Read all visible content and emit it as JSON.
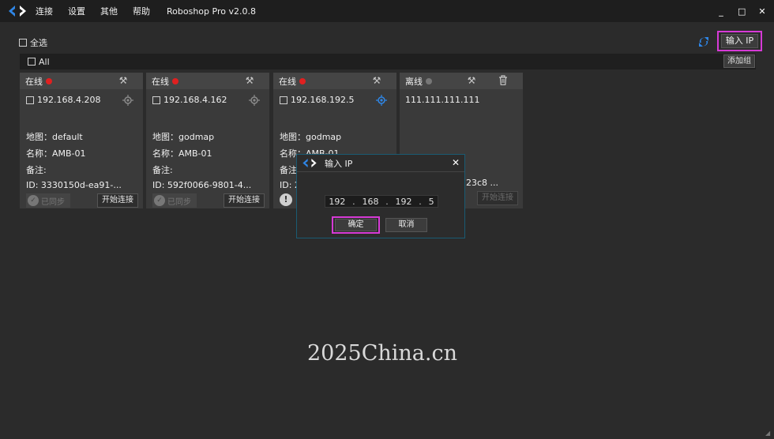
{
  "titlebar": {
    "menu": [
      "连接",
      "设置",
      "其他",
      "帮助"
    ],
    "app_title": "Roboshop Pro v2.0.8",
    "minimize": "_",
    "maximize": "□",
    "close": "✕"
  },
  "toolbar": {
    "select_all_label": "全选",
    "input_ip_label": "输入 IP",
    "add_group_label": "添加组"
  },
  "group": {
    "label": "All"
  },
  "cards": [
    {
      "status": "在线",
      "status_color": "#e02020",
      "ip": "192.168.4.208",
      "map_field": "地图：default",
      "name_field": "名称：AMB-01",
      "note_field": "备注:",
      "id_field": "ID: 3330150d-ea91-...",
      "sync_label": "已同步",
      "connect_label": "开始连接"
    },
    {
      "status": "在线",
      "status_color": "#e02020",
      "ip": "192.168.4.162",
      "map_field": "地图：godmap",
      "name_field": "名称：AMB-01",
      "note_field": "备注:",
      "id_field": "ID: 592f0066-9801-4...",
      "sync_label": "已同步",
      "connect_label": "开始连接"
    },
    {
      "status": "在线",
      "status_color": "#e02020",
      "ip": "192.168.192.5",
      "map_field": "地图：godmap",
      "name_field": "名称：AMB-01",
      "note_field": "备注",
      "id_field": "ID: 2",
      "sync_label": "",
      "connect_label": ""
    },
    {
      "status": "离线",
      "status_color": "#777777",
      "ip": "111.111.111.111",
      "id_field": "23c8 ...",
      "connect_label": "开始连接"
    }
  ],
  "dialog": {
    "title": "输入 IP",
    "close": "✕",
    "ip_octets": [
      "192",
      "168",
      "192",
      "5"
    ],
    "ok_label": "确定",
    "cancel_label": "取消"
  },
  "watermark": "2025China.cn",
  "colors": {
    "accent_highlight": "#d63ad6",
    "online": "#e02020",
    "offline": "#777777",
    "refresh": "#2f86e6"
  },
  "icons": [
    "app-logo-icon",
    "refresh-icon",
    "tools-icon",
    "trash-icon",
    "locate-icon",
    "check-circle-icon",
    "warning-icon",
    "close-icon"
  ]
}
